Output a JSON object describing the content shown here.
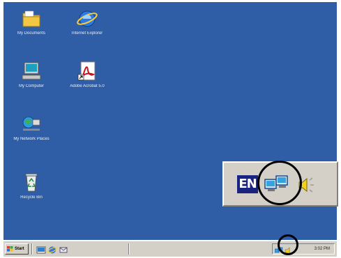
{
  "desktop": {
    "background": "#2f5ea6",
    "icons": [
      {
        "label": "My Documents",
        "icon": "folder-icon"
      },
      {
        "label": "Internet Explorer",
        "icon": "globe-icon"
      },
      {
        "label": "My Computer",
        "icon": "computer-icon"
      },
      {
        "label": "Adobe Acrobat 5.0",
        "icon": "pdf-icon"
      },
      {
        "label": "My Network Places",
        "icon": "network-icon"
      },
      {
        "label": "Recycle Bin",
        "icon": "recycle-bin-icon"
      }
    ]
  },
  "tray_popup": {
    "language": "EN",
    "icons": [
      "network-connection-icon",
      "volume-icon"
    ]
  },
  "taskbar": {
    "start_label": "Start",
    "quick_launch": [
      "desktop-icon",
      "ie-icon",
      "outlook-icon"
    ],
    "clock": "3:02 PM"
  }
}
